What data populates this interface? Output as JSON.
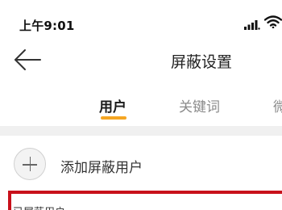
{
  "status_bar": {
    "time": "上午9:01",
    "signal_icon": "signal-strength-icon",
    "wifi_icon": "wifi-icon"
  },
  "nav": {
    "back_icon": "back-arrow-icon",
    "title": "屏蔽设置"
  },
  "tabs": [
    {
      "label": "用户",
      "active": true
    },
    {
      "label": "关键词",
      "active": false
    },
    {
      "label": "微",
      "active": false
    }
  ],
  "add_user": {
    "icon": "plus-icon",
    "label": "添加屏蔽用户"
  },
  "blocked_section": {
    "header": "已屏蔽用户"
  },
  "colors": {
    "accent": "#f5a623",
    "highlight_border": "#c8111b"
  }
}
